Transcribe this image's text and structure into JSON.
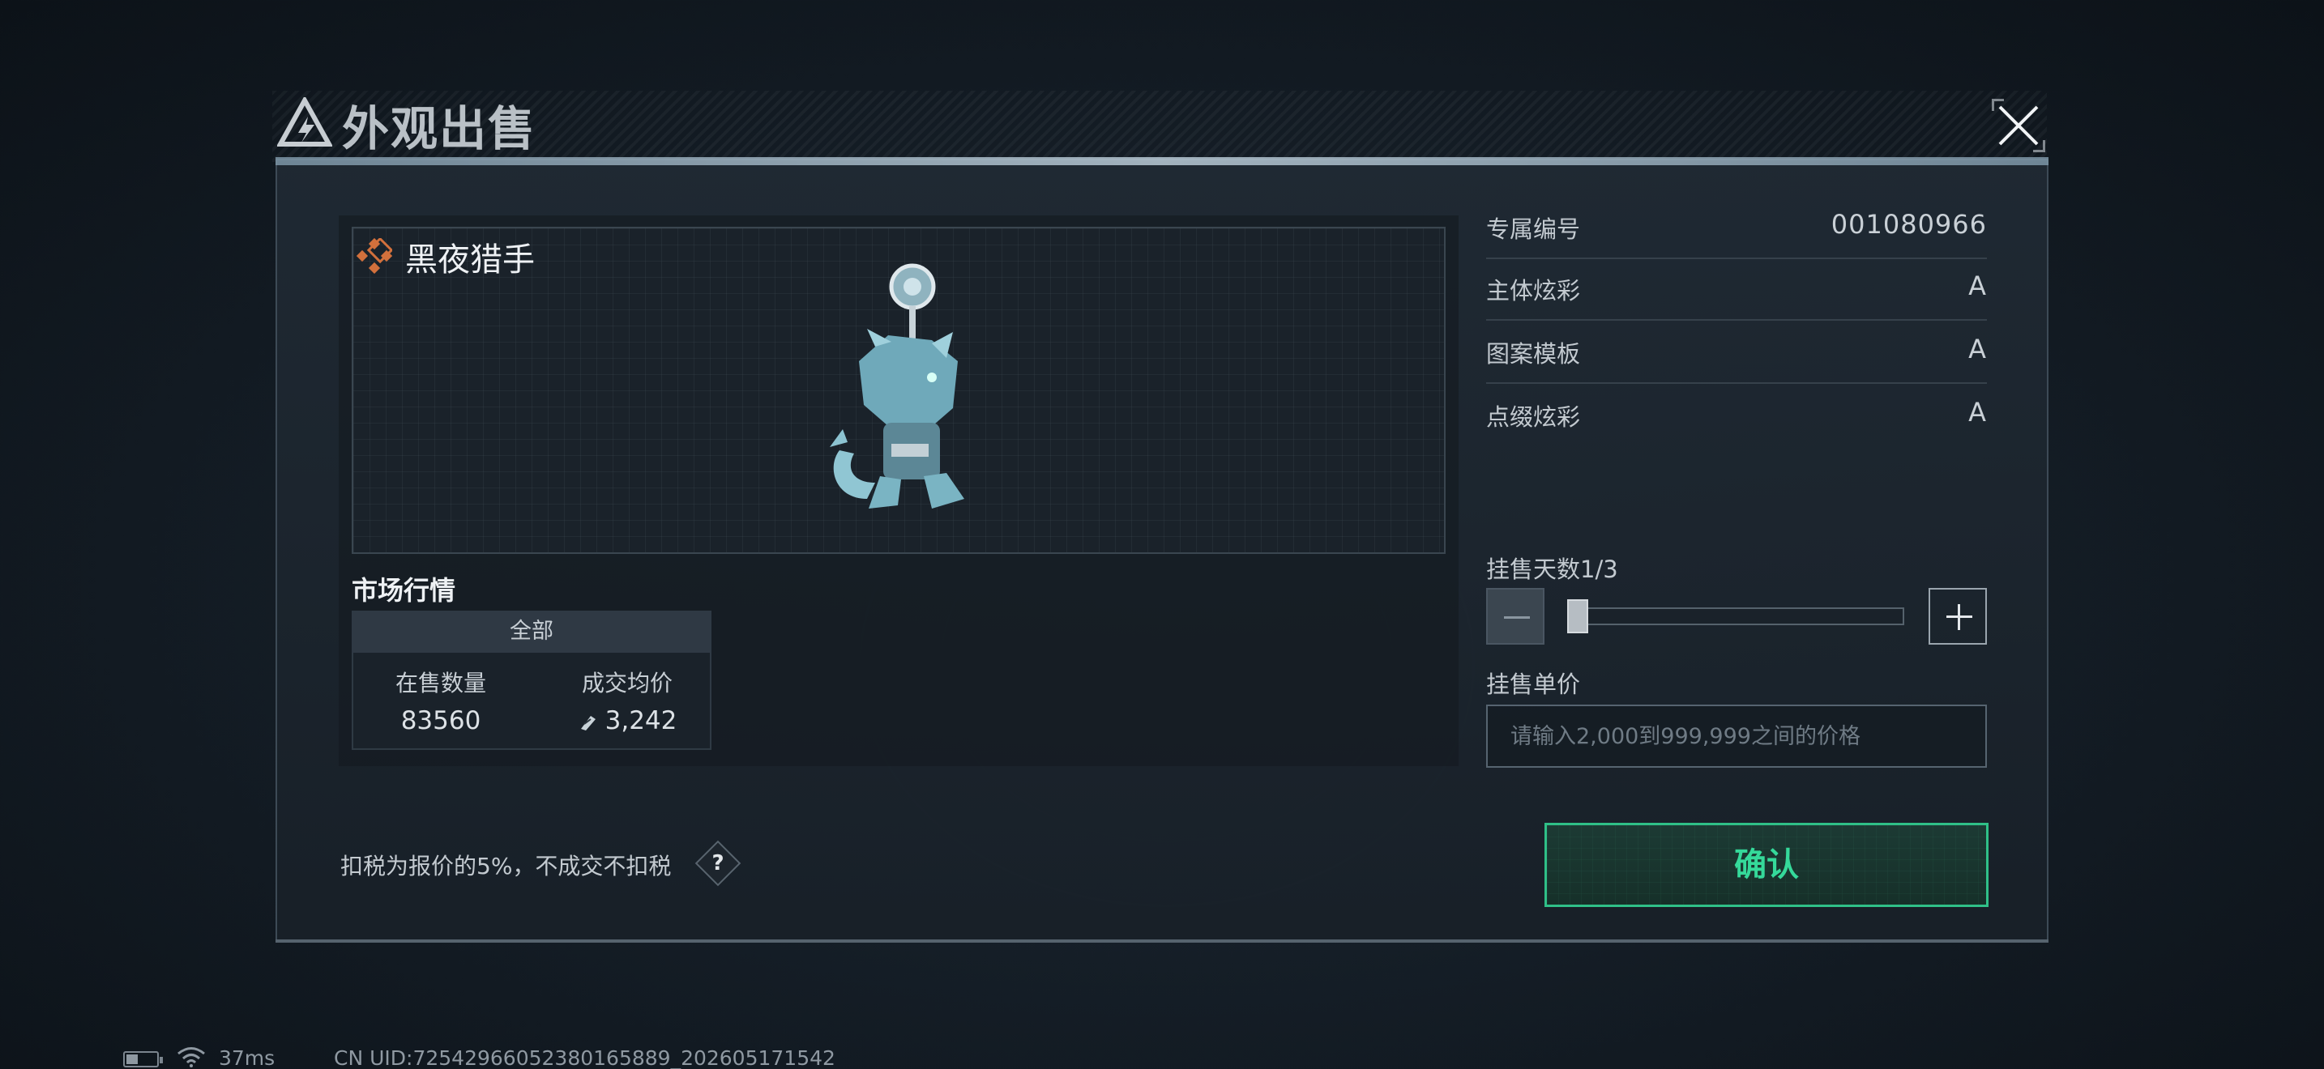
{
  "dialog": {
    "title": "外观出售",
    "close_label": "×"
  },
  "item": {
    "name": "黑夜猎手",
    "badge_color": "#d2703c"
  },
  "market": {
    "title": "市场行情",
    "tab": "全部",
    "columns": [
      "在售数量",
      "成交均价"
    ],
    "on_sale_count": "83560",
    "avg_price": "3,242"
  },
  "details": [
    {
      "label": "专属编号",
      "value": "001080966"
    },
    {
      "label": "主体炫彩",
      "value": "A"
    },
    {
      "label": "图案模板",
      "value": "A"
    },
    {
      "label": "点缀炫彩",
      "value": "A"
    }
  ],
  "listing": {
    "days_label": "挂售天数1/3",
    "days_fraction": 0.0,
    "price_label": "挂售单价",
    "price_placeholder": "请输入2,000到999,999之间的价格",
    "price_value": ""
  },
  "tax_note": "扣税为报价的5%，不成交不扣税",
  "help_label": "?",
  "confirm_label": "确认",
  "status": {
    "ping": "37ms",
    "uid": "CN UID:72542966052380165889_202605171542"
  },
  "colors": {
    "accent_green": "#35d99a",
    "badge_orange": "#d2703c"
  }
}
